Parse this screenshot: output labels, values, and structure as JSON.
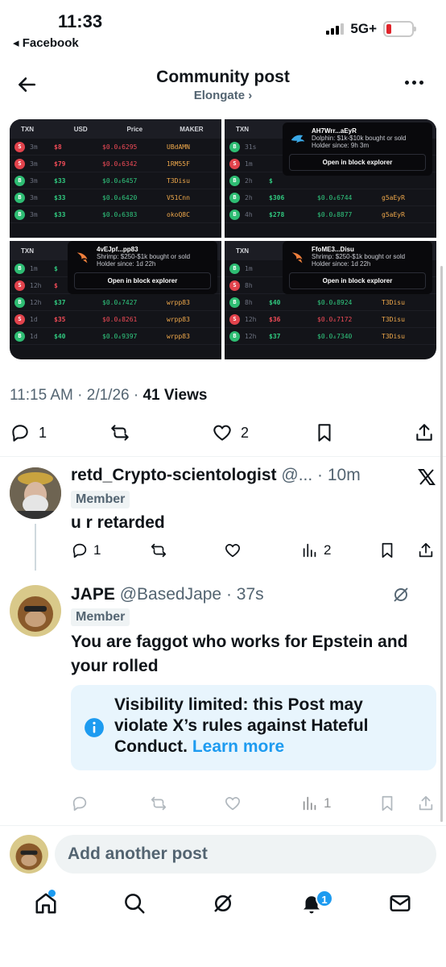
{
  "status": {
    "time": "11:33",
    "back_app": "◂ Facebook",
    "network": "5G+"
  },
  "header": {
    "title": "Community post",
    "subtitle": "Elongate ›"
  },
  "media": {
    "table_headers": [
      "TXN",
      "USD",
      "Price",
      "MAKER"
    ],
    "tile1_rows": [
      {
        "type": "S",
        "age": "3m",
        "usd": "$8",
        "price": "$0.0₄6295",
        "maker": "UBdAMN"
      },
      {
        "type": "S",
        "age": "3m",
        "usd": "$79",
        "price": "$0.0₄6342",
        "maker": "1RM55F"
      },
      {
        "type": "B",
        "age": "3m",
        "usd": "$33",
        "price": "$0.0₄6457",
        "maker": "T3Disu"
      },
      {
        "type": "B",
        "age": "3m",
        "usd": "$33",
        "price": "$0.0₄6420",
        "maker": "V51Cnn"
      },
      {
        "type": "B",
        "age": "3m",
        "usd": "$33",
        "price": "$0.0₄6383",
        "maker": "okoQ8C"
      }
    ],
    "tile2_rows": [
      {
        "type": "B",
        "age": "31s",
        "usd": "",
        "price": "",
        "maker": ""
      },
      {
        "type": "S",
        "age": "1m",
        "usd": "",
        "price": "",
        "maker": ""
      },
      {
        "type": "B",
        "age": "2h",
        "usd": "$",
        "price": "",
        "maker": ""
      },
      {
        "type": "B",
        "age": "2h",
        "usd": "$306",
        "price": "$0.0₄6744",
        "maker": "g5aEyR"
      },
      {
        "type": "B",
        "age": "4h",
        "usd": "$278",
        "price": "$0.0₄8877",
        "maker": "g5aEyR"
      }
    ],
    "tile2_popup": {
      "addr": "AH7Wrr...aEyR",
      "tier": "Dolphin: $1k-$10k bought or sold",
      "since": "Holder since: 9h 3m",
      "button": "Open in block explorer"
    },
    "tile3_rows": [
      {
        "type": "B",
        "age": "1m",
        "usd": "$",
        "price": "",
        "maker": ""
      },
      {
        "type": "S",
        "age": "12h",
        "usd": "$",
        "price": "",
        "maker": ""
      },
      {
        "type": "B",
        "age": "12h",
        "usd": "$37",
        "price": "$0.0₄7427",
        "maker": "wrpp83"
      },
      {
        "type": "S",
        "age": "1d",
        "usd": "$35",
        "price": "$0.0₄8261",
        "maker": "wrpp83"
      },
      {
        "type": "B",
        "age": "1d",
        "usd": "$40",
        "price": "$0.0₄9397",
        "maker": "wrpp83"
      }
    ],
    "tile3_popup": {
      "addr": "4vEJpf...pp83",
      "tier": "Shrimp: $250-$1k bought or sold",
      "since": "Holder since: 1d 22h",
      "button": "Open in block explorer"
    },
    "tile4_rows": [
      {
        "type": "B",
        "age": "1m",
        "usd": "",
        "price": "",
        "maker": ""
      },
      {
        "type": "S",
        "age": "8h",
        "usd": "",
        "price": "",
        "maker": ""
      },
      {
        "type": "B",
        "age": "8h",
        "usd": "$40",
        "price": "$0.0₄8924",
        "maker": "T3Disu"
      },
      {
        "type": "S",
        "age": "12h",
        "usd": "$36",
        "price": "$0.0₄7172",
        "maker": "T3Disu"
      },
      {
        "type": "B",
        "age": "12h",
        "usd": "$37",
        "price": "$0.0₄7340",
        "maker": "T3Disu"
      }
    ],
    "tile4_popup": {
      "addr": "FfoME3...Disu",
      "tier": "Shrimp: $250-$1k bought or sold",
      "since": "Holder since: 1d 22h",
      "button": "Open in block explorer"
    }
  },
  "post_meta": {
    "time": "11:15 AM · 2/1/26 · ",
    "views": "41",
    "views_label": "Views"
  },
  "post_actions": {
    "replies": "1",
    "reposts": "",
    "likes": "2"
  },
  "reply1": {
    "name": "retd_Crypto-scientologist",
    "handle": "@...",
    "time": "· 10m",
    "badge": "Member",
    "text": "u r retarded",
    "replies": "1",
    "views": "2"
  },
  "reply2": {
    "name": "JAPE",
    "handle": "@BasedJape",
    "time": "· 37s",
    "badge": "Member",
    "text": "You are faggot who works for Epstein and your rolled",
    "notice": "Visibility limited: this Post may violate X’s rules against Hateful Conduct.",
    "notice_link": "Learn more",
    "views": "1"
  },
  "composer": {
    "placeholder": "Add another post"
  },
  "tabbar": {
    "notifications_count": "1"
  },
  "colors": {
    "accent": "#1d9bf0",
    "muted": "#536471",
    "notice_bg": "#e8f5fd"
  }
}
